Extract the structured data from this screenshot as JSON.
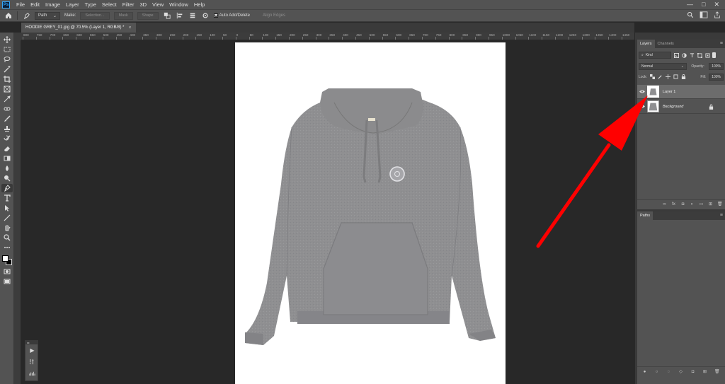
{
  "app": {
    "logo": "Ps"
  },
  "menu": {
    "items": [
      {
        "label": "File"
      },
      {
        "label": "Edit"
      },
      {
        "label": "Image"
      },
      {
        "label": "Layer"
      },
      {
        "label": "Type"
      },
      {
        "label": "Select"
      },
      {
        "label": "Filter"
      },
      {
        "label": "3D"
      },
      {
        "label": "View"
      },
      {
        "label": "Window"
      },
      {
        "label": "Help"
      }
    ]
  },
  "window_controls": {
    "minimize": "—",
    "maximize": "□",
    "close": "✕"
  },
  "options": {
    "mode_value": "Path",
    "make_label": "Make:",
    "selection_btn": "Selection...",
    "mask_btn": "Mask",
    "shape_btn": "Shape",
    "auto_add_delete": "Auto Add/Delete",
    "align_edges": "Align Edges"
  },
  "document": {
    "tab_title": "HOODIE GREY_01.jpg @ 70.5% (Layer 1, RGB/8) *",
    "close_glyph": "×"
  },
  "ruler": {
    "labels": [
      "800",
      "750",
      "700",
      "650",
      "600",
      "550",
      "500",
      "450",
      "400",
      "350",
      "300",
      "250",
      "200",
      "150",
      "100",
      "50",
      "0",
      "50",
      "100",
      "150",
      "200",
      "250",
      "300",
      "350",
      "400",
      "450",
      "500",
      "550",
      "600",
      "650",
      "700",
      "750",
      "800",
      "850",
      "900",
      "950",
      "1000",
      "1050",
      "1100",
      "1150",
      "1200",
      "1250",
      "1300",
      "1350",
      "1400",
      "1450"
    ]
  },
  "layers_panel": {
    "tabs": [
      {
        "label": "Layers"
      },
      {
        "label": "Channels"
      }
    ],
    "kind_value": "Kind",
    "blend_mode": "Normal",
    "opacity_label": "Opacity:",
    "opacity_value": "100%",
    "lock_label": "Lock:",
    "fill_label": "Fill:",
    "fill_value": "100%",
    "layers": [
      {
        "name": "Layer 1",
        "selected": true
      },
      {
        "name": "Background",
        "selected": false,
        "locked": true
      }
    ]
  },
  "paths_panel": {
    "tab_label": "Paths"
  },
  "colors": {
    "ui_panel": "#535353",
    "ui_dark": "#282828",
    "hoodie": "#8f8f91",
    "annotation_arrow": "#ff0000"
  }
}
